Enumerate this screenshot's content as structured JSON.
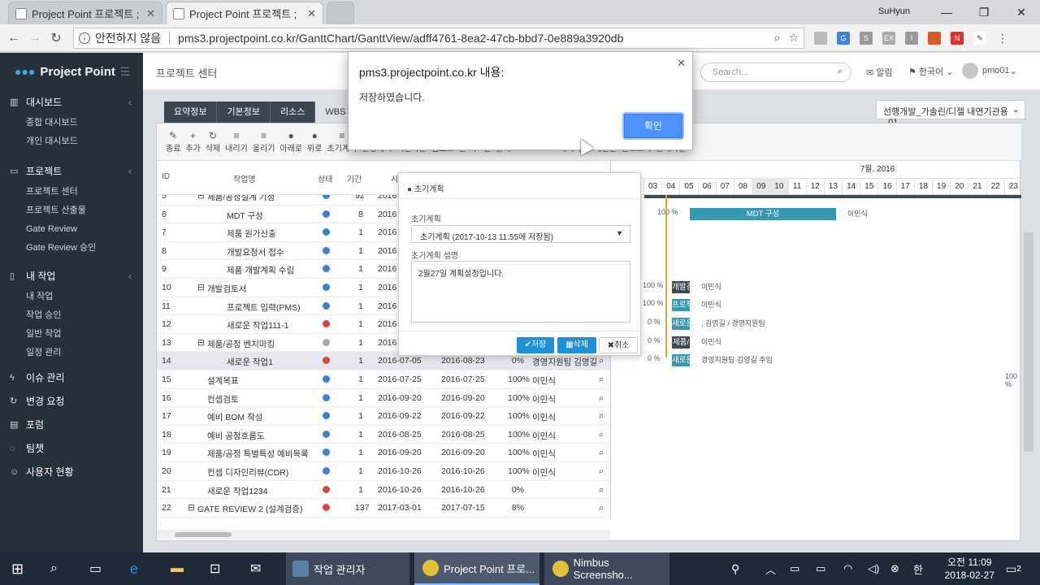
{
  "browser": {
    "tabs": [
      {
        "title": "Project Point 프로젝트 ;"
      },
      {
        "title": "Project Point 프로젝트 ;"
      }
    ],
    "profile": "SuHyun",
    "security_label": "안전하지 않음",
    "url": "pms3.projectpoint.co.kr/GanttChart/GanttView/adff4761-8ea2-47cb-bbd7-0e889a3920db",
    "win_controls": [
      "—",
      "❐",
      "✕"
    ]
  },
  "app": {
    "brand": "Project Point",
    "page_title": "프로젝트 센터",
    "search_placeholder": "Search...",
    "alarm": "알림",
    "language": "한국어",
    "user": "pmo01",
    "project_select": "선행개발_가솔린/디젤 내연기관용_01"
  },
  "sidebar": [
    {
      "label": "대시보드",
      "icon": "bar-chart-icon",
      "items": [
        "종합 대시보드",
        "개인 대시보드"
      ]
    },
    {
      "label": "프로젝트",
      "icon": "monitor-icon",
      "items": [
        "프로젝트 센터",
        "프로젝트 산출물",
        "Gate Review",
        "Gate Review 승인"
      ]
    },
    {
      "label": "내 작업",
      "icon": "doc-icon",
      "items": [
        "내 작업",
        "작업 승인",
        "일반 작업",
        "일정 관리"
      ]
    },
    {
      "label": "이슈 관리",
      "icon": "bolt-icon",
      "items": []
    },
    {
      "label": "변경 요청",
      "icon": "refresh-icon",
      "items": []
    },
    {
      "label": "포럼",
      "icon": "forum-icon",
      "items": []
    },
    {
      "label": "팀챗",
      "icon": "chat-icon",
      "items": []
    },
    {
      "label": "사용자 현황",
      "icon": "users-icon",
      "items": []
    }
  ],
  "project_tabs": [
    "요약정보",
    "기본정보",
    "리소스",
    "WBS"
  ],
  "toolbar": [
    "종료",
    "추가",
    "삭제",
    "내리기",
    "올리기",
    "아래로",
    "위로",
    "초기계획",
    "변경계획",
    "엑셀다운",
    "업로드",
    "일",
    "주",
    "월",
    "분기",
    "PDF",
    "PNG",
    "계획비교",
    "레벨별",
    "필드보기",
    "전체화면"
  ],
  "grid_headers": {
    "id": "ID",
    "name": "작업명",
    "status": "상태",
    "duration": "기간",
    "start": "시"
  },
  "month_label": "7월, 2016",
  "days": [
    "03",
    "04",
    "05",
    "06",
    "07",
    "08",
    "09",
    "10",
    "11",
    "12",
    "13",
    "14",
    "15",
    "16",
    "17",
    "18",
    "19",
    "20",
    "21",
    "22",
    "23"
  ],
  "rows": [
    {
      "id": "5",
      "name": "제품/공정설계 기정",
      "indent": 1,
      "tree": "⊟",
      "status": "blue",
      "dur": "92",
      "start": "2016",
      "end": "",
      "pct": "",
      "owner": ""
    },
    {
      "id": "6",
      "name": "MDT 구성",
      "indent": 2,
      "tree": "",
      "status": "blue",
      "dur": "8",
      "start": "2016",
      "end": "",
      "pct": "",
      "owner": ""
    },
    {
      "id": "7",
      "name": "제품 원가산출",
      "indent": 2,
      "tree": "",
      "status": "blue",
      "dur": "1",
      "start": "2016",
      "end": "",
      "pct": "",
      "owner": ""
    },
    {
      "id": "8",
      "name": "개발요청서 접수",
      "indent": 2,
      "tree": "",
      "status": "blue",
      "dur": "1",
      "start": "2016",
      "end": "",
      "pct": "",
      "owner": ""
    },
    {
      "id": "9",
      "name": "제품 개발계획 수립",
      "indent": 2,
      "tree": "",
      "status": "blue",
      "dur": "1",
      "start": "2016",
      "end": "",
      "pct": "",
      "owner": ""
    },
    {
      "id": "10",
      "name": "개발검토서",
      "indent": 1,
      "tree": "⊟",
      "status": "blue",
      "dur": "1",
      "start": "2016",
      "end": "",
      "pct": "",
      "owner": ""
    },
    {
      "id": "11",
      "name": "프로젝트 입력(PMS)",
      "indent": 2,
      "tree": "",
      "status": "blue",
      "dur": "1",
      "start": "2016",
      "end": "",
      "pct": "",
      "owner": ""
    },
    {
      "id": "12",
      "name": "새로운 작업111-1",
      "indent": 2,
      "tree": "",
      "status": "red",
      "dur": "1",
      "start": "2016",
      "end": "",
      "pct": "",
      "owner": ""
    },
    {
      "id": "13",
      "name": "제품/공정 벤치마킹",
      "indent": 1,
      "tree": "⊟",
      "status": "gray",
      "dur": "1",
      "start": "2016",
      "end": "",
      "pct": "",
      "owner": ""
    },
    {
      "id": "14",
      "name": "새로운 작업1",
      "indent": 2,
      "tree": "",
      "status": "red",
      "dur": "1",
      "start": "2016-07-05",
      "end": "2016-08-23",
      "pct": "0%",
      "owner": "경영지원팀 김영길"
    },
    {
      "id": "15",
      "name": "설계목표",
      "indent": 1,
      "tree": "",
      "status": "blue",
      "dur": "1",
      "start": "2016-07-25",
      "end": "2016-07-25",
      "pct": "100%",
      "owner": "이민식"
    },
    {
      "id": "16",
      "name": "컨셉검토",
      "indent": 1,
      "tree": "",
      "status": "blue",
      "dur": "1",
      "start": "2016-09-20",
      "end": "2016-09-20",
      "pct": "100%",
      "owner": "이민식"
    },
    {
      "id": "17",
      "name": "예비 BOM 작성",
      "indent": 1,
      "tree": "",
      "status": "blue",
      "dur": "1",
      "start": "2016-09-22",
      "end": "2016-09-22",
      "pct": "100%",
      "owner": "이민식"
    },
    {
      "id": "18",
      "name": "예비 공정흐름도",
      "indent": 1,
      "tree": "",
      "status": "blue",
      "dur": "1",
      "start": "2016-08-25",
      "end": "2016-08-25",
      "pct": "100%",
      "owner": "이민식"
    },
    {
      "id": "19",
      "name": "제품/공정 특별특성 예비목록",
      "indent": 1,
      "tree": "",
      "status": "blue",
      "dur": "1",
      "start": "2016-09-20",
      "end": "2016-09-20",
      "pct": "100%",
      "owner": "이민식"
    },
    {
      "id": "20",
      "name": "컨셉 디자인리뷰(CDR)",
      "indent": 1,
      "tree": "",
      "status": "blue",
      "dur": "1",
      "start": "2016-10-26",
      "end": "2016-10-26",
      "pct": "100%",
      "owner": "이민식"
    },
    {
      "id": "21",
      "name": "새로운 작업1234",
      "indent": 1,
      "tree": "",
      "status": "red",
      "dur": "1",
      "start": "2016-10-26",
      "end": "2016-10-26",
      "pct": "0%",
      "owner": ""
    },
    {
      "id": "22",
      "name": "GATE REVIEW 2 (설계검증)",
      "indent": 0,
      "tree": "⊟",
      "status": "red",
      "dur": "137",
      "start": "2017-03-01",
      "end": "2017-07-15",
      "pct": "8%",
      "owner": ""
    }
  ],
  "gantt": {
    "mdt_bar": "MDT 구성",
    "mdt_pct": "100 %",
    "mdt_owner": "이민식",
    "b10": "개발검",
    "b10_pct": "100 %",
    "b10_owner": "이민식",
    "b11": "프로젝",
    "b11_pct": "100 %",
    "b11_owner": "이민식",
    "b12": "새로운",
    "b12_pct": "0 %",
    "b12_owner": ", 김영길 / 경영지원팀",
    "b13": "제품/",
    "b13_pct": "0 %",
    "b13_owner": "이민식",
    "b14": "새로운",
    "b14_pct": "0 %",
    "b14_owner": "경영지원팀 김영길 주임",
    "r15_pct": "100 %"
  },
  "plan_modal": {
    "title": "초기계획",
    "plan_label": "초기계획",
    "plan_value": "초기계획 (2017-10-13 11:55에 저장됨)",
    "desc_label": "초기계획 설명",
    "desc_value": "2월27일 계획설정입니다.",
    "save": "저장",
    "delete": "삭제",
    "cancel": "취소"
  },
  "alert": {
    "title": "pms3.projectpoint.co.kr 내용:",
    "message": "저장하였습니다.",
    "ok": "확인"
  },
  "taskbar": {
    "apps": [
      {
        "label": "작업 관리자"
      },
      {
        "label": "Project Point 프로..."
      },
      {
        "label": "Nimbus Screensho..."
      }
    ],
    "time": "오전 11:09",
    "date": "2018-02-27",
    "ime": "한",
    "notif_count": "2"
  }
}
